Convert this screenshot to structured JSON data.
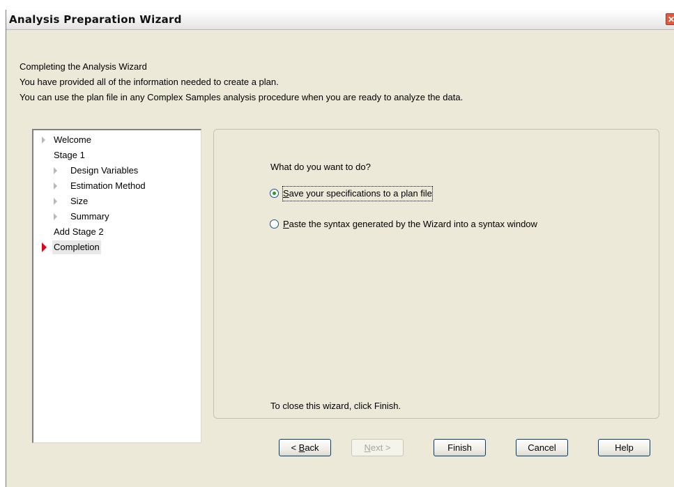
{
  "window": {
    "title": "Analysis Preparation Wizard",
    "close_glyph": "✕",
    "close_icon": "close-icon"
  },
  "intro": {
    "heading": "Completing the Analysis Wizard",
    "line1": "You have provided all of the information needed to create a plan.",
    "line2": "You can use the plan file in any Complex Samples analysis procedure when you are ready to analyze the data."
  },
  "steps": [
    {
      "label": "Welcome",
      "has_marker": true,
      "indent": 0
    },
    {
      "label": "Stage 1",
      "has_marker": false,
      "indent": 0
    },
    {
      "label": "Design Variables",
      "has_marker": true,
      "indent": 1
    },
    {
      "label": "Estimation Method",
      "has_marker": true,
      "indent": 1
    },
    {
      "label": "Size",
      "has_marker": true,
      "indent": 1
    },
    {
      "label": "Summary",
      "has_marker": true,
      "indent": 1
    },
    {
      "label": "Add Stage 2",
      "has_marker": false,
      "indent": 0
    },
    {
      "label": "Completion",
      "has_marker": true,
      "indent": 0,
      "active": true
    }
  ],
  "content": {
    "question": "What do you want to do?",
    "option1": {
      "label": "Save your specifications to a plan file",
      "mnemonic": "S",
      "checked": true
    },
    "option2": {
      "label": "Paste the syntax generated by the Wizard into a syntax window",
      "mnemonic": "P",
      "checked": false
    },
    "closing": "To close this wizard, click Finish."
  },
  "buttons": {
    "back": {
      "prefix": "< ",
      "mnemonic": "B",
      "rest": "ack",
      "enabled": true
    },
    "next": {
      "mnemonic": "N",
      "rest": "ext >",
      "enabled": false
    },
    "finish": "Finish",
    "cancel": "Cancel",
    "help": "Help"
  },
  "colors": {
    "active_marker": "#e3001b",
    "inactive_marker": "#b8b8b8",
    "radio_dot": "#21a121",
    "dialog_bg": "#ece9d8"
  }
}
